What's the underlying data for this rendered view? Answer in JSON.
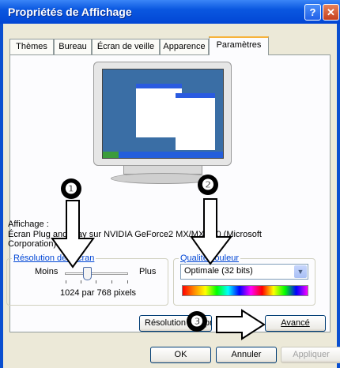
{
  "window": {
    "title": "Propriétés de Affichage",
    "help_button": "?",
    "close_button": "✕"
  },
  "tabs": [
    "Thèmes",
    "Bureau",
    "Écran de veille",
    "Apparence",
    "Paramètres"
  ],
  "active_tab": "Paramètres",
  "annotations": {
    "badge1": "❶",
    "badge2": "❷",
    "badge3": "❸"
  },
  "display": {
    "label": "Affichage :",
    "device_text": "Écran Plug and Play sur NVIDIA GeForce2 MX/MX 400 (Microsoft Corporation)"
  },
  "resolution": {
    "legend": "Résolution de l'écran",
    "min_label": "Moins",
    "max_label": "Plus",
    "value_text": "1024 par 768 pixels",
    "slider_fraction": 0.33
  },
  "color_quality": {
    "legend": "Qualité couleur",
    "selected": "Optimale (32 bits)"
  },
  "buttons": {
    "troubleshoot": "Résolution des problèmes...",
    "advanced": "Avancé",
    "ok": "OK",
    "cancel": "Annuler",
    "apply": "Appliquer"
  },
  "colors": {
    "title_bar": "#0a57e0",
    "dialog_bg": "#ece9d8",
    "link_blue": "#0046d5"
  }
}
